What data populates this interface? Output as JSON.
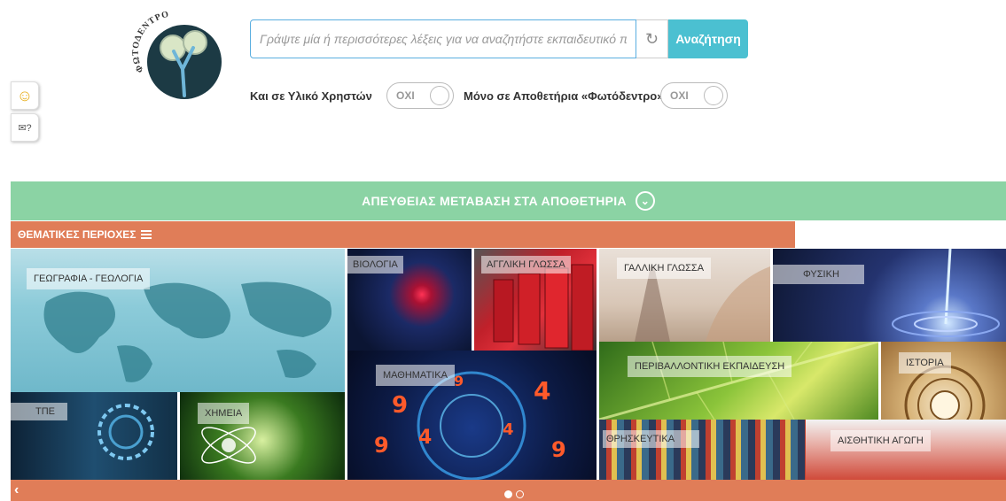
{
  "logo": {
    "text": "ΦΩΤΟΔΕΝΤΡΟ"
  },
  "side_widgets": [
    {
      "icon": "smile-icon",
      "glyph": "☺"
    },
    {
      "icon": "feedback-icon",
      "glyph": "✉?"
    }
  ],
  "search": {
    "placeholder": "Γράψτε μία ή περισσότερες λέξεις για να αναζητήστε εκπαιδευτικό περι",
    "reset_glyph": "↻",
    "button_label": "Αναζήτηση"
  },
  "options": {
    "user_material_label": "Και σε Υλικό Χρηστών",
    "user_material_value": "ΟΧΙ",
    "repo_only_label": "Μόνο σε Αποθετήρια «Φωτόδεντρο»",
    "repo_only_value": "ΟΧΙ"
  },
  "banner": {
    "text": "ΑΠΕΥΘΕΙΑΣ ΜΕΤΑΒΑΣΗ ΣΤΑ ΑΠΟΘΕΤΗΡΙΑ",
    "chevron": "⌄"
  },
  "topics_header": {
    "text": "ΘΕΜΑΤΙΚΕΣ ΠΕΡΙΟΧΕΣ"
  },
  "tiles": {
    "geo": "ΓΕΩΓΡΑΦΙΑ - ΓΕΩΛΟΓΙΑ",
    "bio": "ΒΙΟΛΟΓΙΑ",
    "eng": "ΑΓΓΛΙΚΗ ΓΛΩΣΣΑ",
    "fr": "ΓΑΛΛΙΚΗ ΓΛΩΣΣΑ",
    "phy": "ΦΥΣΙΚΗ",
    "math": "ΜΑΘΗΜΑΤΙΚΑ",
    "env": "ΠΕΡΙΒΑΛΛΟΝΤΙΚΗ ΕΚΠΑΙΔΕΥΣΗ",
    "hist": "ΙΣΤΟΡΙΑ",
    "tpe": "ΤΠΕ",
    "chem": "ΧΗΜΕΙΑ",
    "rel": "ΘΡΗΣΚΕΥΤΙΚΑ",
    "aes": "ΑΙΣΘΗΤΙΚΗ ΑΓΩΓΗ"
  },
  "carousel": {
    "prev": "‹",
    "page_count": 2,
    "active_page": 1
  },
  "colors": {
    "accent": "#4bc0d1",
    "green": "#8bd3a4",
    "orange": "#e07d58"
  }
}
